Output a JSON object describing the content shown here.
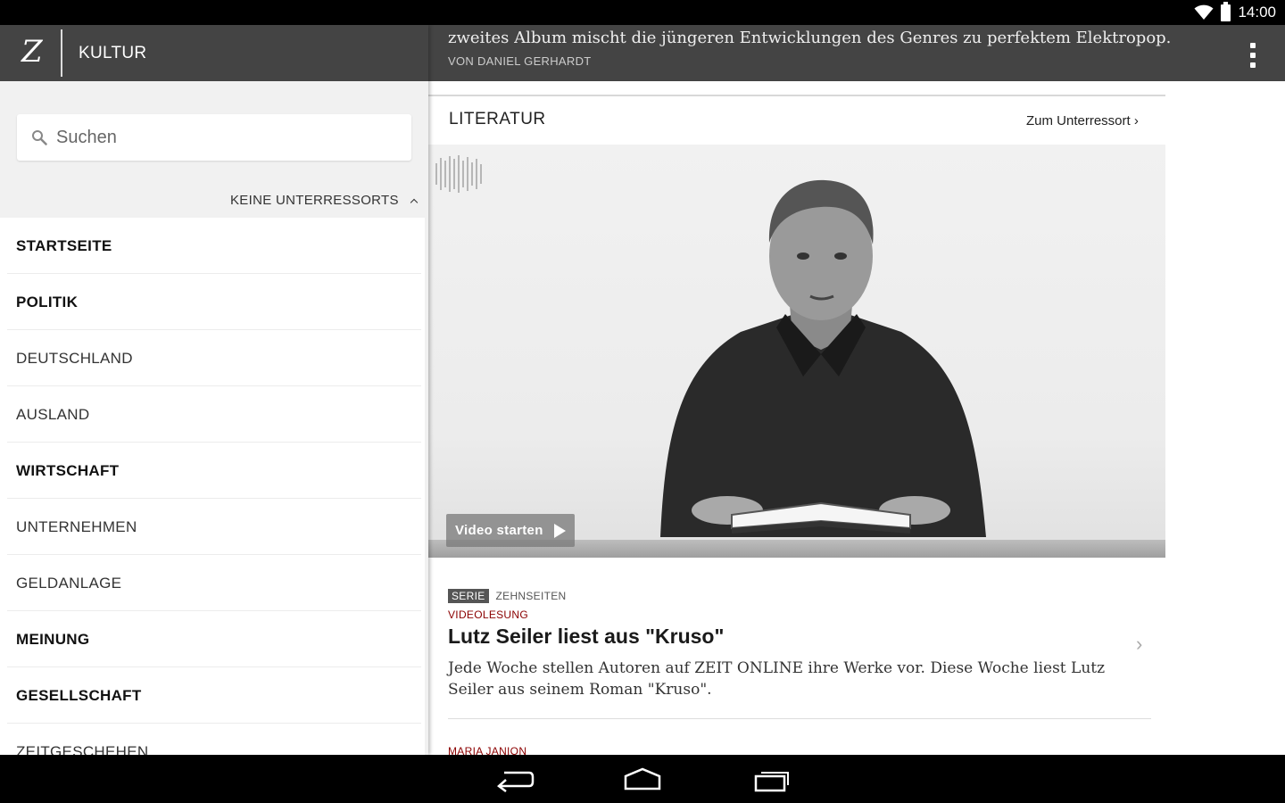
{
  "status_bar": {
    "time": "14:00"
  },
  "header": {
    "logo": "Z",
    "section": "KULTUR"
  },
  "search": {
    "placeholder": "Suchen"
  },
  "subsections_toggle": "KEINE UNTERRESSORTS",
  "nav": [
    {
      "label": "STARTSEITE",
      "bold": true
    },
    {
      "label": "POLITIK",
      "bold": true
    },
    {
      "label": "DEUTSCHLAND",
      "bold": false
    },
    {
      "label": "AUSLAND",
      "bold": false
    },
    {
      "label": "WIRTSCHAFT",
      "bold": true
    },
    {
      "label": "UNTERNEHMEN",
      "bold": false
    },
    {
      "label": "GELDANLAGE",
      "bold": false
    },
    {
      "label": "MEINUNG",
      "bold": true
    },
    {
      "label": "GESELLSCHAFT",
      "bold": true
    },
    {
      "label": "ZEITGESCHEHEN",
      "bold": false
    }
  ],
  "top_teaser": {
    "description": "zweites Album mischt die jüngeren Entwicklungen des Genres zu perfektem Elektropop.",
    "author": "VON DANIEL GERHARDT"
  },
  "section": {
    "title": "LITERATUR",
    "link": "Zum Unterressort ›"
  },
  "video": {
    "play_label": "Video starten"
  },
  "article": {
    "series_badge": "SERIE",
    "series_name": "ZEHNSEITEN",
    "kicker": "VIDEOLESUNG",
    "headline": "Lutz Seiler liest aus \"Kruso\"",
    "teaser": "Jede Woche stellen Autoren auf ZEIT ONLINE ihre Werke vor. Diese Woche liest Lutz Seiler aus seinem Roman \"Kruso\"."
  },
  "next_article": {
    "kicker": "MARIA JANION"
  },
  "icons": {
    "wifi": "wifi-icon",
    "battery": "battery-icon",
    "search": "search-icon",
    "overflow": "overflow-menu-icon",
    "back": "back-icon",
    "home": "home-icon",
    "recents": "recents-icon"
  }
}
